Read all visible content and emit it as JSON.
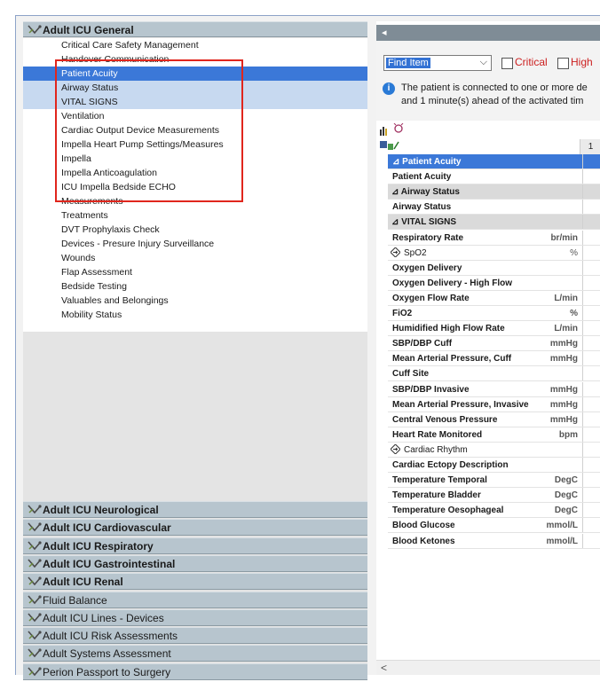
{
  "left_panel": {
    "top_section": "Adult ICU General",
    "items": [
      "Critical Care Safety Management",
      "Handover Communication",
      "Patient Acuity",
      "Airway Status",
      "VITAL SIGNS",
      "Ventilation",
      "Cardiac Output Device Measurements",
      "Impella Heart Pump Settings/Measures",
      "Impella",
      "Impella Anticoagulation",
      "ICU Impella Bedside ECHO",
      "Measurements",
      "Treatments",
      "DVT Prophylaxis Check",
      "Devices - Presure Injury Surveillance",
      "Wounds",
      "Flap Assessment",
      "Bedside Testing",
      "Valuables and Belongings",
      "Mobility Status"
    ],
    "bottom_sections": [
      "Adult ICU Neurological",
      "Adult ICU Cardiovascular",
      "Adult ICU Respiratory",
      "Adult ICU Gastrointestinal",
      "Adult ICU Renal",
      "Fluid Balance",
      "Adult ICU Lines - Devices",
      "Adult ICU Risk Assessments",
      "Adult Systems Assessment",
      "Perion Passport to Surgery"
    ]
  },
  "right_panel": {
    "scroll_left_glyph": "◂",
    "find_item": "Find Item",
    "critical_label": "Critical",
    "high_label": "High",
    "info_line1": "The patient is connected to one or more de",
    "info_line2": "and 1 minute(s) ahead of the activated tim",
    "column_header": "1",
    "hscroll_glyph": "<",
    "rows": [
      {
        "name": "Patient Acuity",
        "unit": "",
        "kind": "selected"
      },
      {
        "name": "Patient Acuity",
        "unit": "",
        "kind": "sub"
      },
      {
        "name": "Airway Status",
        "unit": "",
        "kind": "group"
      },
      {
        "name": "Airway Status",
        "unit": "",
        "kind": "sub"
      },
      {
        "name": "VITAL SIGNS",
        "unit": "",
        "kind": "group"
      },
      {
        "name": "Respiratory Rate",
        "unit": "br/min",
        "kind": "sub"
      },
      {
        "name": "SpO2",
        "unit": "%",
        "kind": "diamond"
      },
      {
        "name": "Oxygen Delivery",
        "unit": "",
        "kind": "sub"
      },
      {
        "name": "Oxygen Delivery - High Flow",
        "unit": "",
        "kind": "sub"
      },
      {
        "name": "Oxygen Flow Rate",
        "unit": "L/min",
        "kind": "sub"
      },
      {
        "name": "FiO2",
        "unit": "%",
        "kind": "sub"
      },
      {
        "name": "Humidified High Flow Rate",
        "unit": "L/min",
        "kind": "sub"
      },
      {
        "name": "SBP/DBP Cuff",
        "unit": "mmHg",
        "kind": "sub"
      },
      {
        "name": "Mean Arterial Pressure, Cuff",
        "unit": "mmHg",
        "kind": "sub"
      },
      {
        "name": "Cuff Site",
        "unit": "",
        "kind": "sub"
      },
      {
        "name": "SBP/DBP Invasive",
        "unit": "mmHg",
        "kind": "sub"
      },
      {
        "name": "Mean Arterial Pressure, Invasive",
        "unit": "mmHg",
        "kind": "sub"
      },
      {
        "name": "Central Venous Pressure",
        "unit": "mmHg",
        "kind": "sub"
      },
      {
        "name": "Heart Rate Monitored",
        "unit": "bpm",
        "kind": "sub"
      },
      {
        "name": "Cardiac Rhythm",
        "unit": "",
        "kind": "diamond"
      },
      {
        "name": "Cardiac Ectopy Description",
        "unit": "",
        "kind": "sub"
      },
      {
        "name": "Temperature Temporal",
        "unit": "DegC",
        "kind": "sub"
      },
      {
        "name": "Temperature Bladder",
        "unit": "DegC",
        "kind": "sub"
      },
      {
        "name": "Temperature Oesophageal",
        "unit": "DegC",
        "kind": "sub"
      },
      {
        "name": "Blood Glucose",
        "unit": "mmol/L",
        "kind": "sub"
      },
      {
        "name": "Blood Ketones",
        "unit": "mmol/L",
        "kind": "sub"
      }
    ]
  },
  "colors": {
    "selection_blue": "#3b78d8",
    "highlight_box": "#e0261d",
    "section_header": "#b7c5ce",
    "critical_red": "#cc2020"
  }
}
